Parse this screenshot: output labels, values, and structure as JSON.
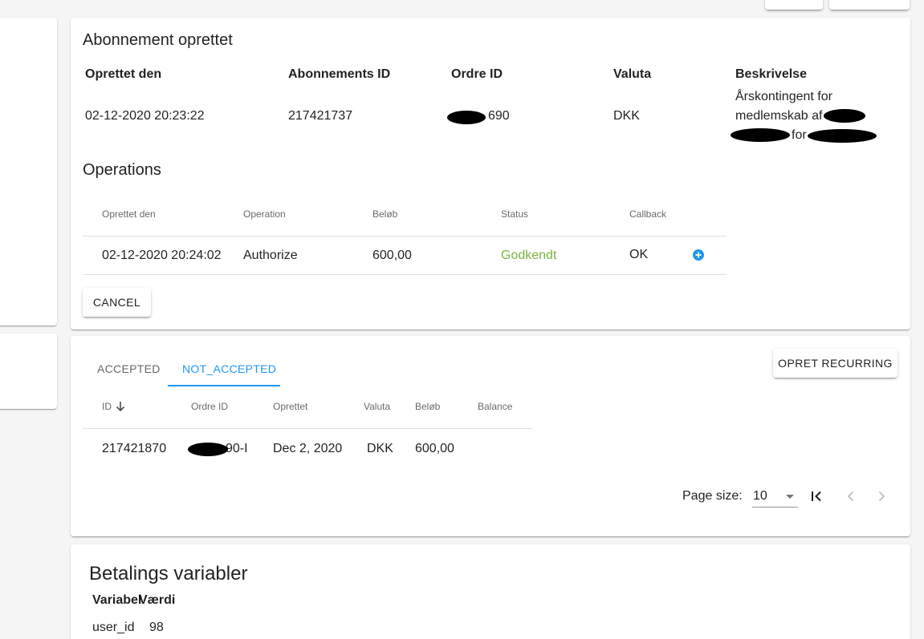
{
  "top_buttons": [
    "",
    ""
  ],
  "subscription": {
    "title": "Abonnement oprettet",
    "headers": {
      "created": "Oprettet den",
      "sub_id": "Abonnements ID",
      "order_id": "Ordre ID",
      "currency": "Valuta",
      "description": "Beskrivelse"
    },
    "values": {
      "created": "02-12-2020 20:23:22",
      "sub_id": "217421737",
      "order_id_suffix": "690",
      "currency": "DKK",
      "desc_line1": "Årskontingent for",
      "desc_line2_prefix": "medlemskab af",
      "desc_line3_mid": "for"
    }
  },
  "operations": {
    "title": "Operations",
    "columns": [
      "Oprettet den",
      "Operation",
      "Beløb",
      "Status",
      "Callback"
    ],
    "row": {
      "created": "02-12-2020 20:24:02",
      "operation": "Authorize",
      "amount": "600,00",
      "status": "Godkendt",
      "callback": "OK"
    },
    "cancel_label": "CANCEL",
    "status_color": "#7cb342"
  },
  "recurring": {
    "tabs": [
      "ACCEPTED",
      "NOT_ACCEPTED"
    ],
    "active_tab": "NOT_ACCEPTED",
    "create_label": "OPRET RECURRING",
    "columns": [
      "ID",
      "Ordre ID",
      "Oprettet",
      "Valuta",
      "Beløb",
      "Balance"
    ],
    "row": {
      "id": "217421870",
      "order_id_suffix": "90-I",
      "created": "Dec 2, 2020",
      "currency": "DKK",
      "amount": "600,00",
      "balance": ""
    },
    "pagination": {
      "page_size_label": "Page size:",
      "page_size": "10"
    }
  },
  "payment_vars": {
    "title": "Betalings variabler",
    "columns": [
      "Variabel",
      "Værdi"
    ],
    "rows": [
      {
        "name": "user_id",
        "value": "98"
      }
    ]
  },
  "colors": {
    "accent": "#2196f3",
    "success": "#7cb342"
  }
}
